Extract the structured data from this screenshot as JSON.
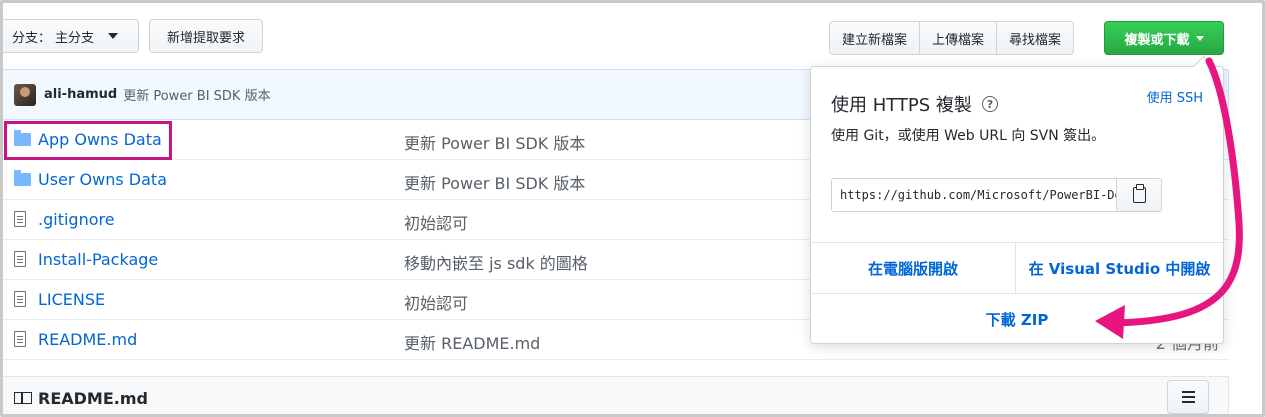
{
  "toolbar": {
    "branch_label": "分支：",
    "branch_value": "主分支",
    "new_pr": "新增提取要求",
    "create_file": "建立新檔案",
    "upload_files": "上傳檔案",
    "find_file": "尋找檔案",
    "clone_download": "複製或下載"
  },
  "commit": {
    "author": "ali-hamud",
    "message": "更新 Power BI SDK 版本"
  },
  "files": [
    {
      "type": "folder",
      "name": "App Owns Data",
      "message": "更新 Power BI SDK 版本",
      "age": ""
    },
    {
      "type": "folder",
      "name": "User Owns Data",
      "message": "更新 Power BI SDK 版本",
      "age": ""
    },
    {
      "type": "file",
      "name": ".gitignore",
      "message": "初始認可",
      "age": ""
    },
    {
      "type": "file",
      "name": "Install-Package",
      "message": "移動內嵌至 js sdk 的圖格",
      "age": ""
    },
    {
      "type": "file",
      "name": "LICENSE",
      "message": "初始認可",
      "age": ""
    },
    {
      "type": "file",
      "name": "README.md",
      "message": "更新 README.md",
      "age": "2 個月前"
    }
  ],
  "readme": {
    "title": "README.md"
  },
  "clone_popover": {
    "title": "使用 HTTPS 複製",
    "use_ssh": "使用 SSH",
    "description": "使用 Git，或使用 Web URL 向 SVN 簽出。",
    "url": "https://github.com/Microsoft/PowerBI-Developer-Samples.git",
    "open_desktop": "在電腦版開啟",
    "open_visual_studio": "在 Visual Studio 中開啟",
    "download_zip": "下載 ZIP"
  },
  "colors": {
    "link": "#0366d6",
    "clone_button": "#28a745",
    "annotation": "#e6157f",
    "highlight_box": "#c2187f"
  }
}
